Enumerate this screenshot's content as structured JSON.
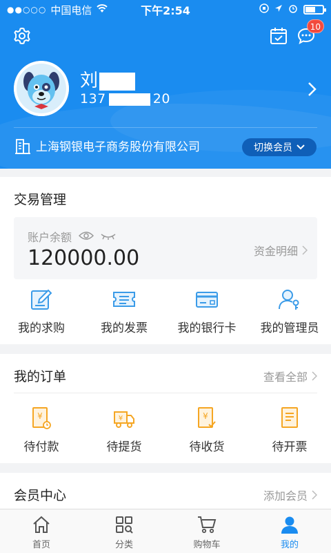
{
  "status_bar": {
    "signal": "●●○○○",
    "carrier": "中国电信",
    "time": "下午2:54"
  },
  "header": {
    "notification_count": "10",
    "user_name": "刘",
    "phone_prefix": "137",
    "phone_suffix": "20",
    "company": "上海钢银电子商务股份有限公司",
    "switch_member": "切换会员"
  },
  "trade": {
    "title": "交易管理",
    "balance_label": "账户余额",
    "balance_value": "120000.00",
    "fund_detail": "资金明细",
    "items": [
      {
        "label": "我的求购",
        "icon": "edit-icon"
      },
      {
        "label": "我的发票",
        "icon": "ticket-icon"
      },
      {
        "label": "我的银行卡",
        "icon": "bank-card-icon"
      },
      {
        "label": "我的管理员",
        "icon": "admin-key-icon"
      }
    ]
  },
  "orders": {
    "title": "我的订单",
    "view_all": "查看全部",
    "items": [
      {
        "label": "待付款",
        "icon": "pay-icon"
      },
      {
        "label": "待提货",
        "icon": "truck-icon"
      },
      {
        "label": "待收货",
        "icon": "receive-icon"
      },
      {
        "label": "待开票",
        "icon": "invoice-icon"
      }
    ]
  },
  "member": {
    "title": "会员中心",
    "add_member": "添加会员"
  },
  "tabbar": {
    "items": [
      {
        "label": "首页",
        "icon": "home-icon"
      },
      {
        "label": "分类",
        "icon": "category-icon"
      },
      {
        "label": "购物车",
        "icon": "cart-icon"
      },
      {
        "label": "我的",
        "icon": "user-icon"
      }
    ],
    "active_index": 3
  },
  "colors": {
    "primary": "#1a8cf0",
    "badge": "#f24a3d",
    "order_icon": "#f5a623",
    "trade_icon": "#3a9be8"
  }
}
